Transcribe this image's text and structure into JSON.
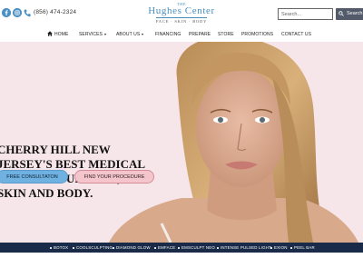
{
  "header": {
    "social": [
      {
        "name": "facebook-icon"
      },
      {
        "name": "instagram-icon"
      }
    ],
    "phone": "(856) 474-2324",
    "logo": {
      "the": "THE",
      "name": "Hughes Center",
      "tagline": "FACE · SKIN · BODY"
    },
    "search": {
      "placeholder": "Search...",
      "button_label": "Search"
    }
  },
  "nav": {
    "items": [
      {
        "label": "HOME",
        "dropdown": false,
        "icon": "home-icon"
      },
      {
        "label": "SERVICES",
        "dropdown": true
      },
      {
        "label": "ABOUT US",
        "dropdown": true
      },
      {
        "label": "FINANCING",
        "dropdown": false
      },
      {
        "label": "PREPARE",
        "dropdown": false
      },
      {
        "label": "STORE",
        "dropdown": false
      },
      {
        "label": "PROMOTIONS",
        "dropdown": false
      },
      {
        "label": "CONTACT US",
        "dropdown": false
      }
    ]
  },
  "hero": {
    "headline_lines": [
      "CHERRY HILL NEW",
      "JERSEY'S BEST MEDICAL",
      "SPA FOR YOUR FACE,",
      "SKIN AND BODY."
    ],
    "cta_primary": "FREE CONSULTATON",
    "cta_secondary": "FIND YOUR PROCEDURE",
    "background_color": "#f7e6e9"
  },
  "treatments_bar": {
    "items": [
      "BOTOX",
      "COOLSCULPTING",
      "DIAMOND GLOW",
      "EMFACE",
      "EMSCULPT NEO",
      "INTENSE PULSED LIGHT",
      "EXION",
      "PEEL BAR"
    ],
    "background_color": "#1a2b4a"
  },
  "colors": {
    "accent_blue": "#6fb1e0",
    "accent_pink": "#f4c5cd",
    "logo_blue": "#4a8ec0",
    "search_button": "#535b6b"
  }
}
